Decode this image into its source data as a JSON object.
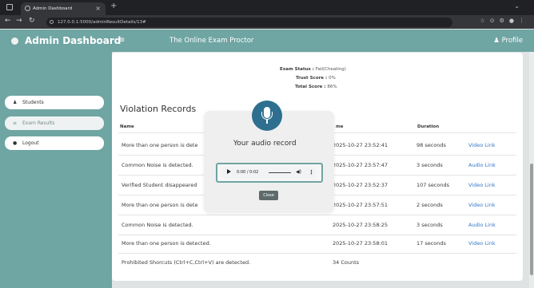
{
  "browser": {
    "tab_title": "Admin Dashboard",
    "url": "127.0.0.1:5000/adminResultDetails/13#"
  },
  "header": {
    "brand": "Admin Dashboard",
    "title": "The Online Exam Proctor",
    "profile": "Profile"
  },
  "sidebar": {
    "items": [
      {
        "label": "Students",
        "icon": "user-icon"
      },
      {
        "label": "Exam Results",
        "icon": "list-icon"
      },
      {
        "label": "Logout",
        "icon": "logout-icon"
      }
    ]
  },
  "status": {
    "exam_status_label": "Exam Status :",
    "exam_status_value": "Fail(Cheating)",
    "trust_score_label": "Trust Score :",
    "trust_score_value": "0%",
    "total_score_label": "Total Score :",
    "total_score_value": "86%"
  },
  "violations": {
    "title": "Violation Records",
    "columns": [
      "Name",
      "me",
      "Duration"
    ],
    "rows": [
      {
        "name": "More than one person is dete",
        "time": "2025-10-27 23:52:41",
        "duration": "98 seconds",
        "link": "Video Link"
      },
      {
        "name": "Common Noise is detected.",
        "time": "2025-10-27 23:57:47",
        "duration": "3 seconds",
        "link": "Audio Link"
      },
      {
        "name": "Verified Student disappeared",
        "time": "2025-10-27 23:52:37",
        "duration": "107 seconds",
        "link": "Video Link"
      },
      {
        "name": "More than one person is dete",
        "time": "2025-10-27 23:57:51",
        "duration": "2 seconds",
        "link": "Video Link"
      },
      {
        "name": "Common Noise is detected.",
        "time": "2025-10-27 23:58:25",
        "duration": "3 seconds",
        "link": "Audio Link"
      },
      {
        "name": "More than one person is detected.",
        "time": "2025-10-27 23:58:01",
        "duration": "17 seconds",
        "link": "Video Link"
      },
      {
        "name": "Prohibited Shorcuts (Ctrl+C,Ctrl+V) are detected.",
        "time": "34 Counts",
        "duration": "",
        "link": ""
      }
    ]
  },
  "modal": {
    "title": "Your audio record",
    "audio_time": "0:00 / 0:02",
    "close_label": "Close"
  }
}
